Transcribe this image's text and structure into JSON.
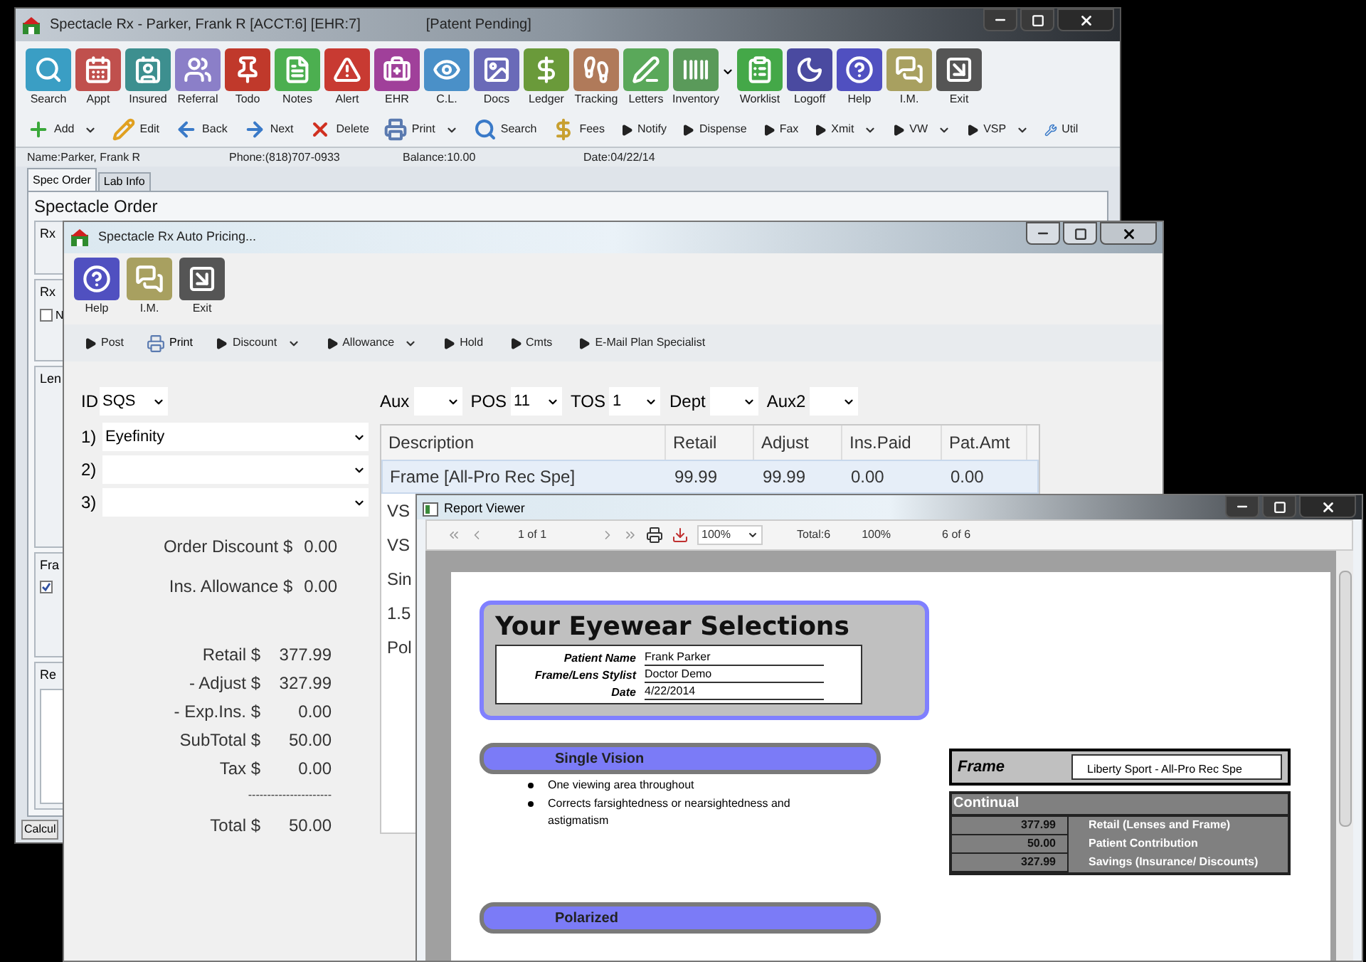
{
  "main_window": {
    "title": "Spectacle Rx - Parker, Frank R [ACCT:6] [EHR:7]",
    "subtitle": "[Patent Pending]",
    "icon_toolbar": [
      {
        "label": "Search",
        "color": "#3a9ec4"
      },
      {
        "label": "Appt",
        "color": "#c0504d"
      },
      {
        "label": "Insured",
        "color": "#3d8f8f"
      },
      {
        "label": "Referral",
        "color": "#8b7fc8"
      },
      {
        "label": "Todo",
        "color": "#c0392b"
      },
      {
        "label": "Notes",
        "color": "#4caf50"
      },
      {
        "label": "Alert",
        "color": "#c83a32"
      },
      {
        "label": "EHR",
        "color": "#a0409a"
      },
      {
        "label": "C.L.",
        "color": "#4a90c8"
      },
      {
        "label": "Docs",
        "color": "#6a6ab8"
      },
      {
        "label": "Ledger",
        "color": "#6a9a3a"
      },
      {
        "label": "Tracking",
        "color": "#b07a5a"
      },
      {
        "label": "Letters",
        "color": "#5aa85a"
      },
      {
        "label": "Inventory",
        "color": "#5a9a5a"
      },
      {
        "label": "Worklist",
        "color": "#44a848"
      },
      {
        "label": "Logoff",
        "color": "#4a4aa0"
      },
      {
        "label": "Help",
        "color": "#5050c0"
      },
      {
        "label": "I.M.",
        "color": "#a8a060"
      },
      {
        "label": "Exit",
        "color": "#555555"
      }
    ],
    "action_toolbar": [
      {
        "label": "Add",
        "dropdown": true
      },
      {
        "label": "Edit",
        "dropdown": false
      },
      {
        "label": "Back",
        "dropdown": false
      },
      {
        "label": "Next",
        "dropdown": false
      },
      {
        "label": "Delete",
        "dropdown": false
      },
      {
        "label": "Print",
        "dropdown": true
      },
      {
        "label": "Search",
        "dropdown": false
      },
      {
        "label": "Fees",
        "dropdown": false
      },
      {
        "label": "Notify",
        "dropdown": false
      },
      {
        "label": "Dispense",
        "dropdown": false
      },
      {
        "label": "Fax",
        "dropdown": false
      },
      {
        "label": "Xmit",
        "dropdown": true
      },
      {
        "label": "VW",
        "dropdown": true
      },
      {
        "label": "VSP",
        "dropdown": true
      },
      {
        "label": "Util",
        "dropdown": false
      }
    ],
    "info_bar": [
      "Name:Parker, Frank R",
      "Phone:(818)707-0933",
      "Balance:10.00",
      "Date:04/22/14"
    ],
    "tabs": [
      {
        "label": "Spec Order",
        "selected": true
      },
      {
        "label": "Lab Info",
        "selected": false
      }
    ],
    "order_panel": {
      "heading": "Spectacle Order",
      "sections": [
        {
          "kind": "tab",
          "label": "Rx"
        },
        {
          "kind": "check",
          "label": "Rx",
          "check_label": "N",
          "checked": false
        },
        {
          "kind": "plain",
          "label": "Len"
        },
        {
          "kind": "check",
          "label": "Fra",
          "checked": true
        },
        {
          "kind": "memo",
          "label": "Re"
        }
      ],
      "button": "Calcul"
    }
  },
  "pricing_window": {
    "title": "Spectacle Rx Auto Pricing...",
    "icon_toolbar": [
      {
        "label": "Help",
        "color": "#5050c0"
      },
      {
        "label": "I.M.",
        "color": "#a8a060"
      },
      {
        "label": "Exit",
        "color": "#555555"
      }
    ],
    "action_toolbar": [
      {
        "label": "Post",
        "dropdown": false
      },
      {
        "label": "Print",
        "dropdown": false
      },
      {
        "label": "Discount",
        "dropdown": true
      },
      {
        "label": "Allowance",
        "dropdown": true
      },
      {
        "label": "Hold",
        "dropdown": false
      },
      {
        "label": "Cmts",
        "dropdown": false
      },
      {
        "label": "E-Mail Plan Specialist",
        "dropdown": false
      }
    ],
    "id_field": {
      "label": "ID",
      "value": "SQS"
    },
    "top_fields": [
      {
        "label": "Aux"
      },
      {
        "label": "POS",
        "value": "11"
      },
      {
        "label": "TOS",
        "value": "1"
      },
      {
        "label": "Dept"
      },
      {
        "label": "Aux2"
      }
    ],
    "plans": [
      {
        "label": "1)",
        "value": "Eyefinity"
      },
      {
        "label": "2)"
      },
      {
        "label": "3)"
      }
    ],
    "adjustments": [
      {
        "label": "Order Discount $",
        "value": "0.00"
      },
      {
        "label": "Ins. Allowance $",
        "value": "0.00"
      }
    ],
    "totals": [
      {
        "label": "Retail $",
        "value": "377.99"
      },
      {
        "label": "- Adjust $",
        "value": "327.99"
      },
      {
        "label": "- Exp.Ins. $",
        "value": "0.00"
      },
      {
        "label": "SubTotal $",
        "value": "50.00"
      },
      {
        "label": "Tax $",
        "value": "0.00"
      }
    ],
    "separator": "----------------------",
    "total": {
      "label": "Total $",
      "value": "50.00"
    },
    "table": {
      "columns": [
        "Description",
        "Retail",
        "Adjust",
        "Ins.Paid",
        "Pat.Amt"
      ],
      "rows": [
        {
          "cells": [
            "Frame [All-Pro Rec Spe]",
            "99.99",
            "99.99",
            "0.00",
            "0.00"
          ],
          "selected": true
        },
        {
          "cells": [
            "VS"
          ],
          "selected": false
        },
        {
          "cells": [
            "VS"
          ],
          "selected": false
        },
        {
          "cells": [
            "Sin"
          ],
          "selected": false
        },
        {
          "cells": [
            "1.5"
          ],
          "selected": false
        },
        {
          "cells": [
            "Pol"
          ],
          "selected": false
        }
      ]
    }
  },
  "report_window": {
    "title": "Report Viewer",
    "toolbar": {
      "page": "1 of 1",
      "zoom": "100%",
      "total": "Total:6",
      "percent": "100%",
      "position": "6 of 6"
    },
    "document": {
      "heading": "Your Eyewear Selections",
      "fields": [
        {
          "label": "Patient Name",
          "value": "Frank Parker"
        },
        {
          "label": "Frame/Lens Stylist",
          "value": "Doctor Demo"
        },
        {
          "label": "Date",
          "value": "4/22/2014"
        }
      ],
      "sections": [
        {
          "title": "Single Vision",
          "bullets": [
            "One viewing area throughout",
            "Corrects farsightedness or nearsightedness and astigmatism"
          ]
        },
        {
          "title": "Polarized"
        }
      ],
      "frame": {
        "label": "Frame",
        "value": "Liberty Sport - All-Pro Rec Spe"
      },
      "summary": {
        "title": "Continual",
        "rows": [
          {
            "amount": "377.99",
            "label": "Retail (Lenses and Frame)"
          },
          {
            "amount": "50.00",
            "label": "Patient Contribution"
          },
          {
            "amount": "327.99",
            "label": "Savings (Insurance/ Discounts)"
          }
        ]
      }
    }
  }
}
